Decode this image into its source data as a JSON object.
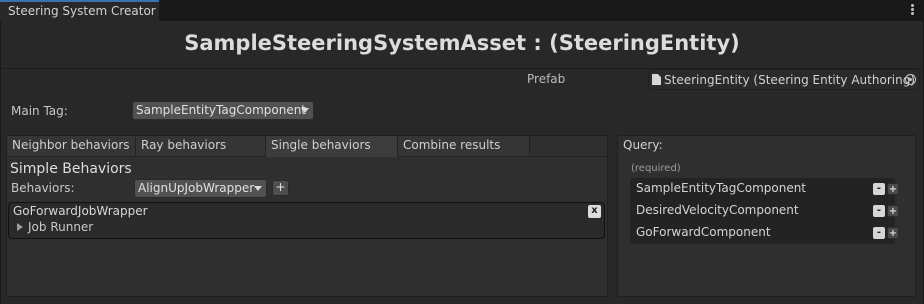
{
  "window": {
    "tab_title": "Steering System Creator"
  },
  "header": {
    "title": "SampleSteeringSystemAsset :  (SteeringEntity)"
  },
  "prefab": {
    "label": "Prefab",
    "value": "SteeringEntity (Steering Entity Authoring)"
  },
  "main_tag": {
    "label": "Main Tag:",
    "value": "SampleEntityTagComponent"
  },
  "tabs": [
    {
      "label": "Neighbor behaviors"
    },
    {
      "label": "Ray behaviors"
    },
    {
      "label": "Single behaviors"
    },
    {
      "label": "Combine results"
    }
  ],
  "active_tab": "Single behaviors",
  "single": {
    "section_title": "Simple Behaviors",
    "behaviors_label": "Behaviors:",
    "behaviors_value": "AlignUpJobWrapper",
    "add_label": "+",
    "item": {
      "name": "GoForwardJobWrapper",
      "close_label": "x",
      "foldout": "Job Runner"
    }
  },
  "query": {
    "label": "Query:",
    "required_label": "(required)",
    "components": [
      {
        "name": "SampleEntityTagComponent"
      },
      {
        "name": "DesiredVelocityComponent"
      },
      {
        "name": "GoForwardComponent"
      }
    ],
    "minus_label": "-",
    "plus_label": "+"
  }
}
